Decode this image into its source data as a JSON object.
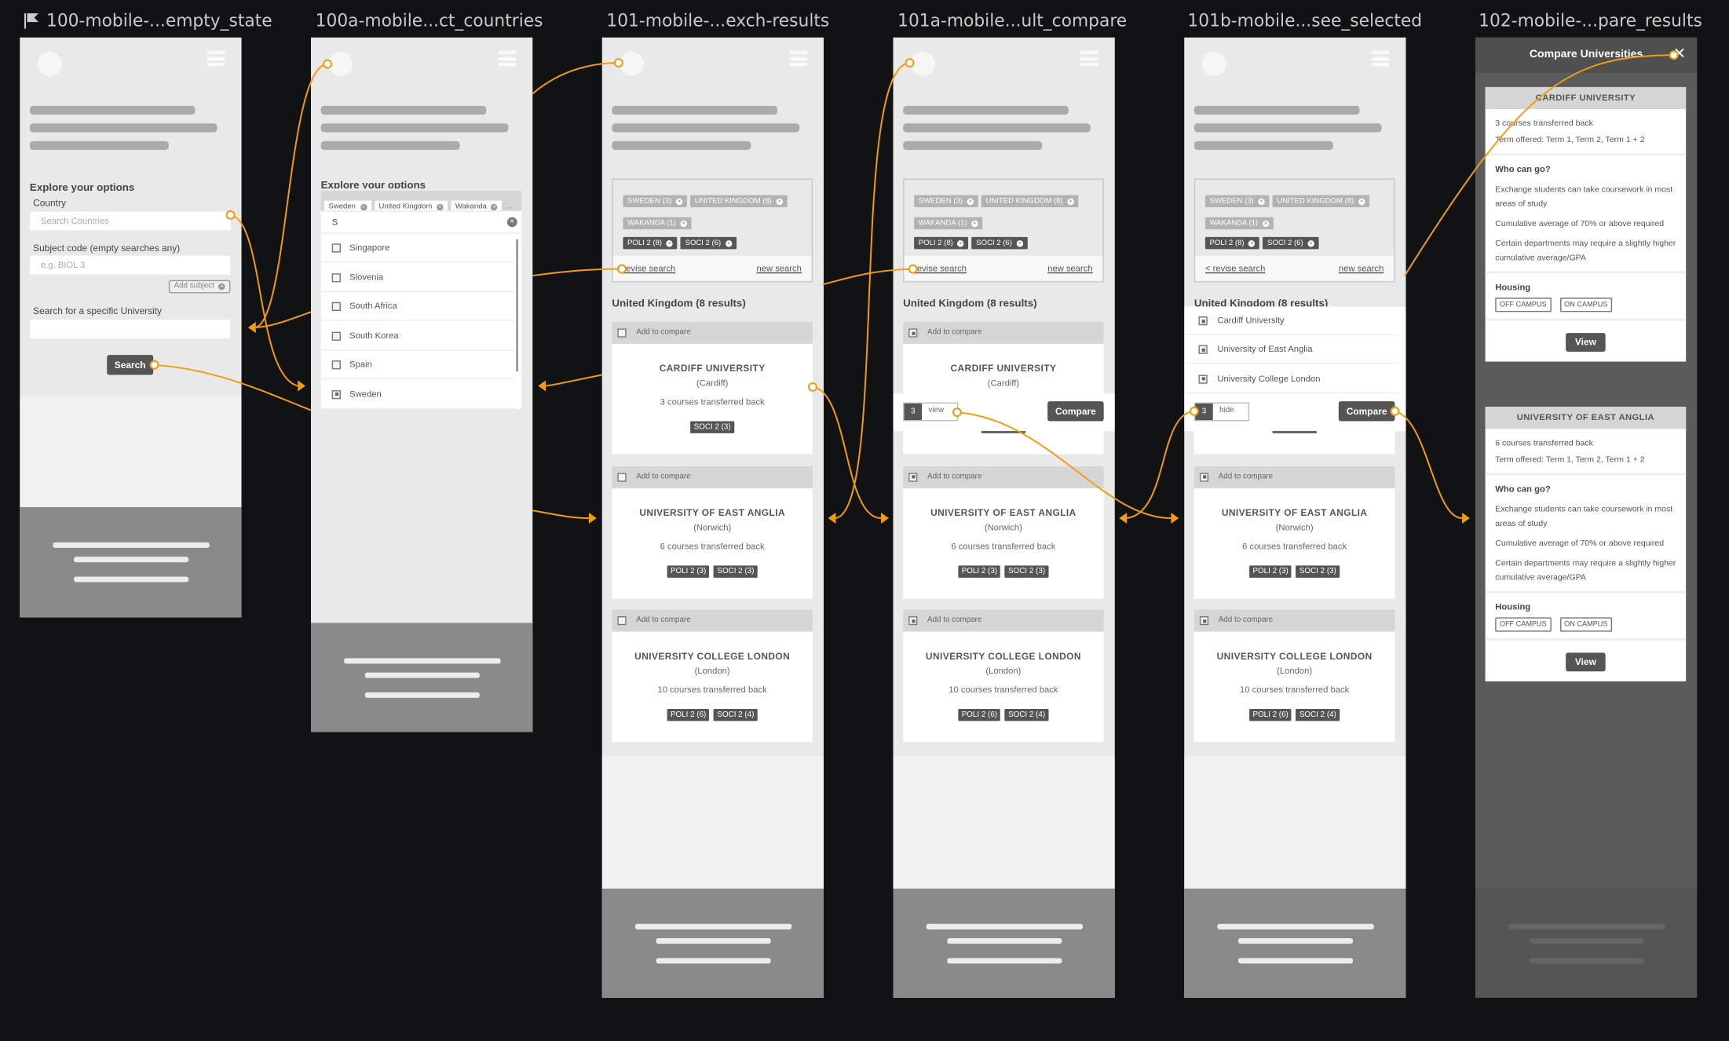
{
  "accent_color": "#f39c12",
  "screens": [
    {
      "title": "100-mobile-...empty_state",
      "flagged": true
    },
    {
      "title": "100a-mobile...ct_countries"
    },
    {
      "title": "101-mobile-...exch-results"
    },
    {
      "title": "101a-mobile...ult_compare"
    },
    {
      "title": "101b-mobile...see_selected"
    },
    {
      "title": "102-mobile-...pare_results"
    }
  ],
  "search_form": {
    "heading": "Explore your options",
    "country_label": "Country",
    "country_placeholder": "Search Countries",
    "subject_label": "Subject code (empty searches any)",
    "subject_placeholder": "e.g. BIOL 3",
    "add_subject": "Add subject",
    "university_label": "Search for a specific University",
    "search_button": "Search"
  },
  "country_picker": {
    "selected": [
      "Sweden",
      "United Kingdom",
      "Wakanda"
    ],
    "more": "...",
    "query": "S",
    "options": [
      {
        "label": "Singapore",
        "checked": false
      },
      {
        "label": "Slovenia",
        "checked": false
      },
      {
        "label": "South Africa",
        "checked": false
      },
      {
        "label": "South Korea",
        "checked": false
      },
      {
        "label": "Spain",
        "checked": false
      },
      {
        "label": "Sweden",
        "checked": true
      }
    ]
  },
  "filters": {
    "countries": [
      "SWEDEN (3)",
      "UNITED KINGDOM (8)",
      "WAKANDA (1)"
    ],
    "subjects": [
      "POLI 2 (8)",
      "SOCI 2 (6)"
    ],
    "revise": "revise search",
    "revise_back": "< revise search",
    "new": "new search"
  },
  "results": {
    "heading": "United Kingdom (8 results)",
    "add_to_compare": "Add to compare",
    "cards": [
      {
        "name": "CARDIFF UNIVERSITY",
        "city": "(Cardiff)",
        "courses": "3 courses transferred back",
        "tags": [
          "SOCI 2 (3)"
        ]
      },
      {
        "name": "UNIVERSITY OF EAST ANGLIA",
        "city": "(Norwich)",
        "courses": "6 courses transferred back",
        "tags": [
          "POLI 2 (3)",
          "SOCI 2 (3)"
        ]
      },
      {
        "name": "UNIVERSITY COLLEGE LONDON",
        "city": "(London)",
        "courses": "10 courses transferred back",
        "tags": [
          "POLI 2 (6)",
          "SOCI 2 (4)"
        ]
      }
    ]
  },
  "compare_bar": {
    "count": "3",
    "view": "view",
    "hide": "hide",
    "compare": "Compare"
  },
  "selected_list": [
    "Cardiff University",
    "University of East Anglia",
    "University College London"
  ],
  "compare": {
    "title": "Compare Universities",
    "cards": [
      {
        "name": "CARDIFF UNIVERSITY",
        "courses": "3 courses transferred back"
      },
      {
        "name": "UNIVERSITY OF EAST ANGLIA",
        "courses": "6 courses transferred back"
      }
    ],
    "term": "Term offered: Term 1, Term 2, Term 1 + 2",
    "who_heading": "Who can go?",
    "who": [
      "Exchange students can take coursework in most areas of study",
      "Cumulative average of 70% or above required",
      "Certain departments may require a slightly higher cumulative average/GPA"
    ],
    "housing_heading": "Housing",
    "housing": [
      "OFF CAMPUS",
      "ON CAMPUS"
    ],
    "view": "View"
  }
}
